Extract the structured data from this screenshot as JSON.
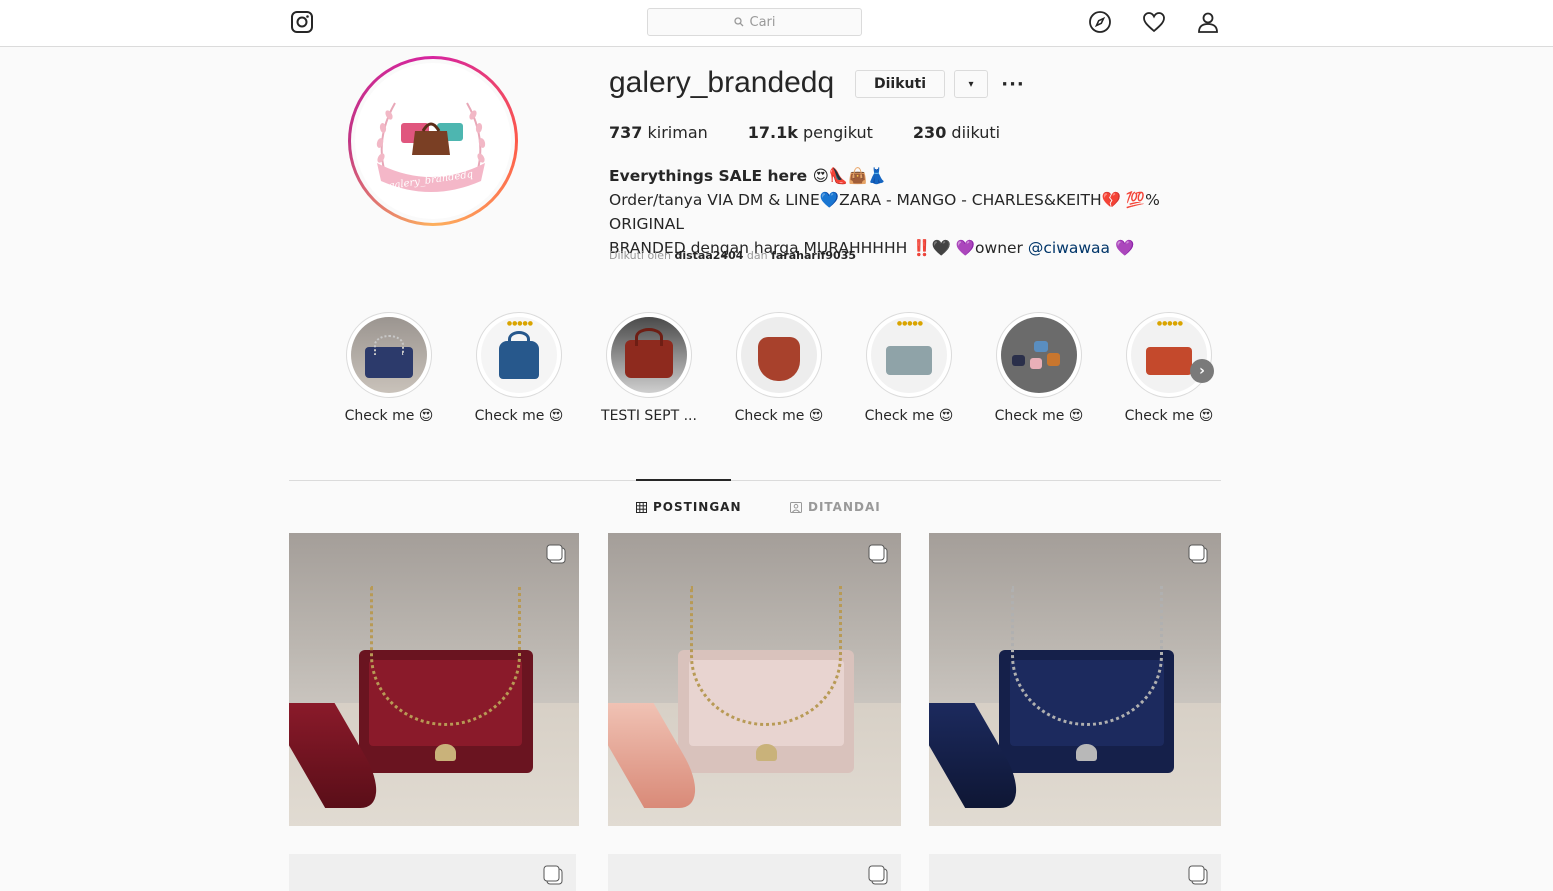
{
  "header": {
    "search_placeholder": "Cari"
  },
  "profile": {
    "username": "galery_brandedq",
    "follow_button": "Diikuti",
    "dropdown_glyph": "▾",
    "more_glyph": "···",
    "stats": {
      "posts_count": "737",
      "posts_label": "kiriman",
      "followers_count": "17.1k",
      "followers_label": "pengikut",
      "following_count": "230",
      "following_label": "diikuti"
    },
    "bio": {
      "name": "Everythings SALE here 😍👠👜👗",
      "line1": "Order/tanya VIA DM & LINE💙ZARA - MANGO - CHARLES&KEITH💔 💯% ORIGINAL",
      "line2_pre": "BRANDED dengan harga MURAHHHHH ‼️🖤 💜owner ",
      "mention": "@ciwawaa",
      "line2_post": " 💜"
    },
    "followed_by": {
      "prefix": "Diikuti oleh",
      "user1": "distaa2404",
      "conj": "dan",
      "user2": "faraharif9035"
    }
  },
  "highlights": [
    {
      "label": "Check me 😍",
      "color": "#2c3a6b"
    },
    {
      "label": "Check me 😍",
      "color": "#27588c"
    },
    {
      "label": "TESTI SEPT ...",
      "color": "#8e2a1e"
    },
    {
      "label": "Check me 😍",
      "color": "#a8412c"
    },
    {
      "label": "Check me 😍",
      "color": "#8fa3a8"
    },
    {
      "label": "Check me 😍",
      "color": "#5a5a5a"
    },
    {
      "label": "Check me 😍",
      "color": "#c4492c"
    }
  ],
  "tabs": {
    "posts": "POSTINGAN",
    "tagged": "DITANDAI"
  },
  "posts": [
    {
      "bag_color": "#8a1a2a",
      "tassel_color": "#6a1420"
    },
    {
      "bag_color": "#e8d4d0",
      "tassel_color": "#e6a89a"
    },
    {
      "bag_color": "#1c2a5e",
      "tassel_color": "#1a2450"
    }
  ]
}
